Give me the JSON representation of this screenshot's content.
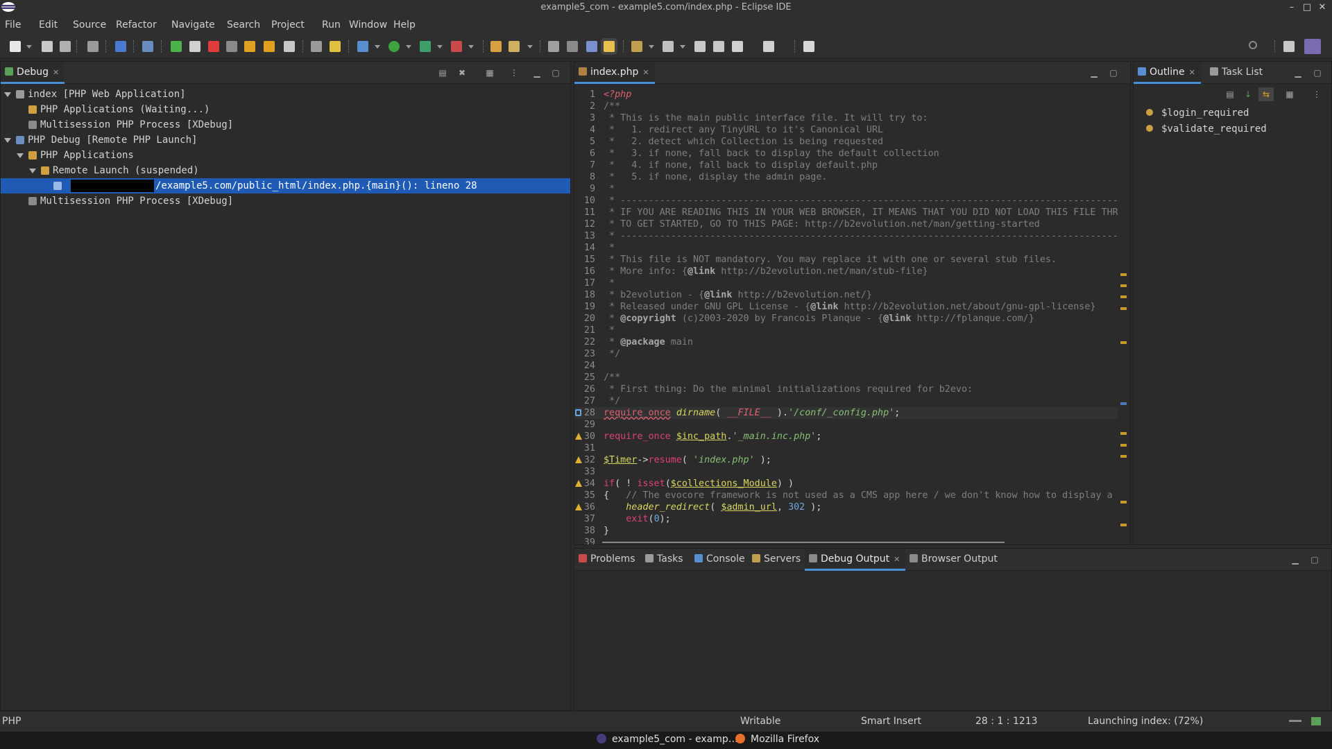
{
  "window": {
    "title": "example5_com - example5.com/index.php - Eclipse IDE",
    "controls": [
      "–",
      "□",
      "✕"
    ]
  },
  "menu": [
    "File",
    "Edit",
    "Source",
    "Refactor",
    "Navigate",
    "Search",
    "Project",
    "Run",
    "Window",
    "Help"
  ],
  "debug_view": {
    "tab_label": "Debug",
    "tree": [
      {
        "label": "index [PHP Web Application]",
        "depth": 0,
        "expanded": true,
        "icon": "php-app-icon"
      },
      {
        "label": "PHP Applications (Waiting...)",
        "depth": 1,
        "expanded": null,
        "icon": "php-debug-target-icon"
      },
      {
        "label": "Multisession PHP Process [XDebug]",
        "depth": 1,
        "expanded": null,
        "icon": "process-icon"
      },
      {
        "label": "PHP Debug [Remote PHP Launch]",
        "depth": 0,
        "expanded": true,
        "icon": "remote-launch-icon"
      },
      {
        "label": "PHP Applications",
        "depth": 1,
        "expanded": true,
        "icon": "php-debug-target-icon"
      },
      {
        "label": "Remote Launch (suspended)",
        "depth": 2,
        "expanded": true,
        "icon": "suspended-thread-icon"
      },
      {
        "label": "/example5.com/public_html/index.php.{main}(): lineno 28",
        "depth": 3,
        "expanded": null,
        "icon": "stack-frame-icon",
        "selected": true,
        "redacted_prefix": true
      },
      {
        "label": "Multisession PHP Process [XDebug]",
        "depth": 1,
        "expanded": null,
        "icon": "process-icon"
      }
    ]
  },
  "editor": {
    "tab_label": "index.php",
    "current_line": 28,
    "lines": [
      [
        [
          "k-php",
          "<?php"
        ]
      ],
      [
        [
          "k-com",
          "/**"
        ]
      ],
      [
        [
          "k-com",
          " * This is the main public interface file. It will try to:"
        ]
      ],
      [
        [
          "k-com",
          " *   1. redirect any TinyURL to it's Canonical URL"
        ]
      ],
      [
        [
          "k-com",
          " *   2. detect which Collection is being requested"
        ]
      ],
      [
        [
          "k-com",
          " *   3. if none, fall back to display the default collection"
        ]
      ],
      [
        [
          "k-com",
          " *   4. if none, fall back to display default.php"
        ]
      ],
      [
        [
          "k-com",
          " *   5. if none, display the admin page."
        ]
      ],
      [
        [
          "k-com",
          " *"
        ]
      ],
      [
        [
          "k-com",
          " * -------------------------------------------------------------------------------------------------------"
        ]
      ],
      [
        [
          "k-com",
          " * IF YOU ARE READING THIS IN YOUR WEB BROWSER, IT MEANS THAT YOU DID NOT LOAD THIS FILE THROUGH"
        ]
      ],
      [
        [
          "k-com",
          " * TO GET STARTED, GO TO THIS PAGE: http://b2evolution.net/man/getting-started"
        ]
      ],
      [
        [
          "k-com",
          " * -------------------------------------------------------------------------------------------------------"
        ]
      ],
      [
        [
          "k-com",
          " *"
        ]
      ],
      [
        [
          "k-com",
          " * This file is NOT mandatory. You may replace it with one or several stub files."
        ]
      ],
      [
        [
          "k-com",
          " * More info: {"
        ],
        [
          "k-cb",
          "@link"
        ],
        [
          "k-com",
          " http://b2evolution.net/man/stub-file}"
        ]
      ],
      [
        [
          "k-com",
          " *"
        ]
      ],
      [
        [
          "k-com",
          " * b2evolution - {"
        ],
        [
          "k-cb",
          "@link"
        ],
        [
          "k-com",
          " http://b2evolution.net/}"
        ]
      ],
      [
        [
          "k-com",
          " * Released under GNU GPL License - {"
        ],
        [
          "k-cb",
          "@link"
        ],
        [
          "k-com",
          " http://b2evolution.net/about/gnu-gpl-license}"
        ]
      ],
      [
        [
          "k-com",
          " * "
        ],
        [
          "k-cb",
          "@copyright"
        ],
        [
          "k-com",
          " (c)2003-2020 by Francois Planque - {"
        ],
        [
          "k-cb",
          "@link"
        ],
        [
          "k-com",
          " http://fplanque.com/}"
        ]
      ],
      [
        [
          "k-com",
          " *"
        ]
      ],
      [
        [
          "k-com",
          " * "
        ],
        [
          "k-cb",
          "@package"
        ],
        [
          "k-com",
          " main"
        ]
      ],
      [
        [
          "k-com",
          " */"
        ]
      ],
      [],
      [
        [
          "k-com",
          "/**"
        ]
      ],
      [
        [
          "k-com",
          " * First thing: Do the minimal initializations required for b2evo:"
        ]
      ],
      [
        [
          "k-com",
          " */"
        ]
      ],
      [
        [
          "k-err",
          "require_once"
        ],
        [
          "k-txt",
          " "
        ],
        [
          "k-fn",
          "dirname"
        ],
        [
          "k-txt",
          "( "
        ],
        [
          "k-php",
          "__FILE__"
        ],
        [
          "k-txt",
          " )."
        ],
        [
          "k-str",
          "'/conf/_config.php'"
        ],
        [
          "k-txt",
          ";"
        ]
      ],
      [],
      [
        [
          "k-kw",
          "require_once"
        ],
        [
          "k-txt",
          " "
        ],
        [
          "k-var",
          "$inc_path"
        ],
        [
          "k-txt",
          "."
        ],
        [
          "k-str",
          "'_main.inc.php'"
        ],
        [
          "k-txt",
          ";"
        ]
      ],
      [],
      [
        [
          "k-var",
          "$Timer"
        ],
        [
          "k-txt",
          "->"
        ],
        [
          "k-kw",
          "resume"
        ],
        [
          "k-txt",
          "( "
        ],
        [
          "k-str",
          "'index.php'"
        ],
        [
          "k-txt",
          " );"
        ]
      ],
      [],
      [
        [
          "k-kw",
          "if"
        ],
        [
          "k-txt",
          "( ! "
        ],
        [
          "k-kw",
          "isset"
        ],
        [
          "k-txt",
          "("
        ],
        [
          "k-var",
          "$collections_Module"
        ],
        [
          "k-txt",
          ") )"
        ]
      ],
      [
        [
          "k-txt",
          "{   "
        ],
        [
          "k-com",
          "// The evocore framework is not used as a CMS app here / we don't know how to display a public"
        ]
      ],
      [
        [
          "k-txt",
          "    "
        ],
        [
          "k-fn",
          "header_redirect"
        ],
        [
          "k-txt",
          "( "
        ],
        [
          "k-var",
          "$admin_url"
        ],
        [
          "k-txt",
          ", "
        ],
        [
          "k-num",
          "302"
        ],
        [
          "k-txt",
          " );"
        ]
      ],
      [
        [
          "k-txt",
          "    "
        ],
        [
          "k-kw",
          "exit"
        ],
        [
          "k-txt",
          "("
        ],
        [
          "k-num",
          "0"
        ],
        [
          "k-txt",
          ");"
        ]
      ],
      [
        [
          "k-txt",
          "}"
        ]
      ],
      []
    ],
    "warning_lines": [
      30,
      32,
      34,
      36
    ]
  },
  "outline": {
    "tabs": [
      "Outline",
      "Task List"
    ],
    "items": [
      "$login_required",
      "$validate_required"
    ]
  },
  "bottom_panel": {
    "tabs": [
      "Problems",
      "Tasks",
      "Console",
      "Servers",
      "Debug Output",
      "Browser Output"
    ],
    "active_tab": "Debug Output"
  },
  "status": {
    "language": "PHP",
    "writable": "Writable",
    "insert_mode": "Smart Insert",
    "position": "28 : 1 : 1213",
    "progress": "Launching index: (72%)"
  },
  "taskbar": {
    "items": [
      "example5_com - examp…",
      "Mozilla Firefox"
    ]
  }
}
